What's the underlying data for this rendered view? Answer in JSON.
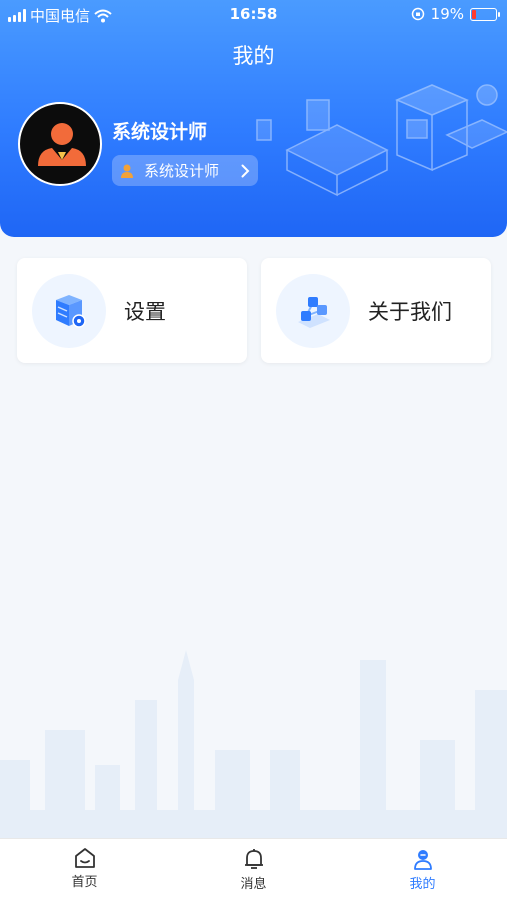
{
  "status_bar": {
    "carrier": "中国电信",
    "time": "16:58",
    "battery_percent": "19%",
    "battery_level": 0.19,
    "battery_color": "#ff3b30"
  },
  "header": {
    "title": "我的",
    "user_name": "系统设计师",
    "role_label": "系统设计师",
    "avatar_icon": "person-avatar-icon"
  },
  "menu": {
    "settings_label": "设置",
    "about_label": "关于我们"
  },
  "tabbar": {
    "tabs": [
      {
        "label": "首页",
        "icon": "home-icon"
      },
      {
        "label": "消息",
        "icon": "bell-icon"
      },
      {
        "label": "我的",
        "icon": "user-icon"
      }
    ],
    "active_index": 2,
    "active_color": "#2f7cff"
  },
  "colors": {
    "accent": "#2f7cff",
    "role_icon": "#f2a23a",
    "avatar_figure": "#f26b3a"
  }
}
